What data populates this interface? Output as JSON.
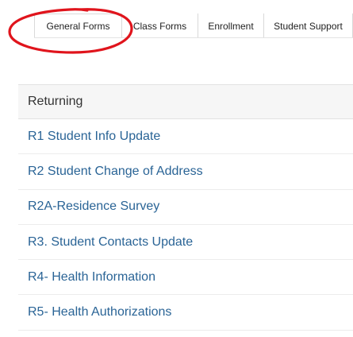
{
  "tabs": [
    {
      "label": "General Forms",
      "active": true
    },
    {
      "label": "Class Forms",
      "active": false
    },
    {
      "label": "Enrollment",
      "active": false
    },
    {
      "label": "Student Support",
      "active": false
    }
  ],
  "list": {
    "header": "Returning",
    "items": [
      "R1 Student Info Update",
      "R2 Student Change of Address",
      "R2A-Residence Survey",
      "R3. Student Contacts Update",
      "R4- Health Information",
      "R5- Health Authorizations"
    ]
  },
  "colors": {
    "link": "#2a6496",
    "annotation": "#e0141c",
    "header_bg": "#f6f6f6"
  }
}
